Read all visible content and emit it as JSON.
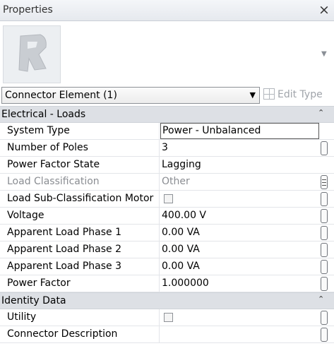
{
  "window": {
    "title": "Properties",
    "close_glyph": "×"
  },
  "type_selector": {
    "selected": "Connector Element (1)",
    "dropdown_glyph": "▼"
  },
  "edit_type": {
    "label": "Edit Type",
    "icon": "edit-type-icon"
  },
  "preview": {
    "dropdown_glyph": "▼"
  },
  "groups": {
    "electrical": {
      "label": "Electrical - Loads",
      "collapse_glyph": "⌃",
      "rows": {
        "system_type": {
          "name": "System Type",
          "value": "Power - Unbalanced"
        },
        "poles": {
          "name": "Number of Poles",
          "value": "3"
        },
        "pf_state": {
          "name": "Power Factor State",
          "value": "Lagging"
        },
        "load_class": {
          "name": "Load Classification",
          "value": "Other"
        },
        "sub_class": {
          "name": "Load Sub-Classification Motor",
          "checked": false
        },
        "voltage": {
          "name": "Voltage",
          "value": "400.00 V"
        },
        "phase1": {
          "name": "Apparent Load Phase 1",
          "value": "0.00 VA"
        },
        "phase2": {
          "name": "Apparent Load Phase 2",
          "value": "0.00 VA"
        },
        "phase3": {
          "name": "Apparent Load Phase 3",
          "value": "0.00 VA"
        },
        "power_factor": {
          "name": "Power Factor",
          "value": "1.000000"
        }
      }
    },
    "identity": {
      "label": "Identity Data",
      "collapse_glyph": "⌃",
      "rows": {
        "utility": {
          "name": "Utility",
          "checked": false
        },
        "connector_desc": {
          "name": "Connector Description",
          "value": ""
        }
      }
    }
  }
}
